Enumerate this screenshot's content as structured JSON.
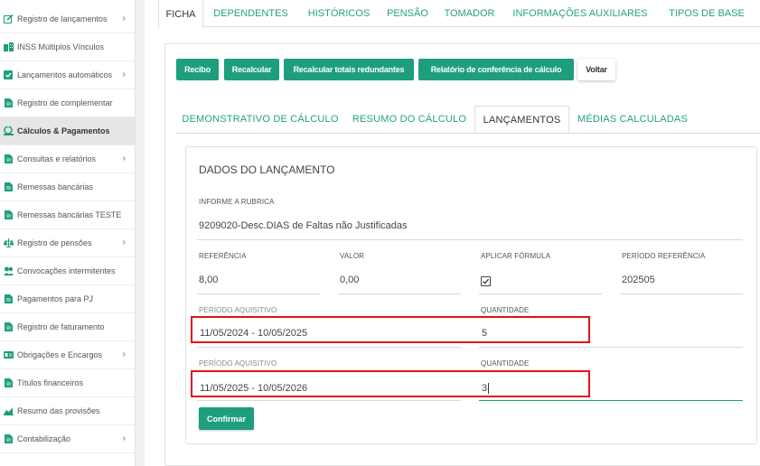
{
  "sidebar": {
    "items": [
      {
        "label": "Registro de lançamentos",
        "icon": "edit-icon",
        "chevron": true
      },
      {
        "label": "INSS Múltiplos Vínculos",
        "icon": "building-icon",
        "chevron": false
      },
      {
        "label": "Lançamentos automáticos",
        "icon": "check-square-icon",
        "chevron": true
      },
      {
        "label": "Registro de complementar",
        "icon": "document-icon",
        "chevron": false
      },
      {
        "label": "Cálculos & Pagamentos",
        "icon": "money-icon",
        "chevron": false,
        "active": true
      },
      {
        "label": "Consultas e relatórios",
        "icon": "document-icon",
        "chevron": true
      },
      {
        "label": "Remessas bancárias",
        "icon": "document-icon",
        "chevron": false
      },
      {
        "label": "Remessas bancárias TESTE",
        "icon": "document-icon",
        "chevron": false
      },
      {
        "label": "Registro de pensões",
        "icon": "balance-icon",
        "chevron": true
      },
      {
        "label": "Convocações intermitentes",
        "icon": "users-icon",
        "chevron": false
      },
      {
        "label": "Pagamentos para PJ",
        "icon": "document-icon",
        "chevron": false
      },
      {
        "label": "Registro de faturamento",
        "icon": "document-icon",
        "chevron": false
      },
      {
        "label": "Obrigações e Encargos",
        "icon": "id-card-icon",
        "chevron": true
      },
      {
        "label": "Títulos financeiros",
        "icon": "document-icon",
        "chevron": false
      },
      {
        "label": "Resumo das provisões",
        "icon": "area-chart-icon",
        "chevron": false
      },
      {
        "label": "Contabilização",
        "icon": "document-icon",
        "chevron": true
      }
    ]
  },
  "top_tabs": [
    "FICHA",
    "DEPENDENTES",
    "HISTÓRICOS",
    "PENSÃO",
    "TOMADOR",
    "INFORMAÇÕES AUXILIARES",
    "TIPOS DE BASE"
  ],
  "toolbar": {
    "recibo": "Recibo",
    "recalcular": "Recalcular",
    "recalcular_totais": "Recalcular totais redundantes",
    "relatorio": "Relatório de conferência de cálculo",
    "voltar": "Voltar"
  },
  "inner_tabs": [
    "DEMONSTRATIVO DE CÁLCULO",
    "RESUMO DO CÁLCULO",
    "LANÇAMENTOS",
    "MÉDIAS CALCULADAS"
  ],
  "panel": {
    "title": "DADOS DO LANÇAMENTO",
    "rubrica_label": "INFORME A RUBRICA",
    "rubrica_value": "9209020-Desc.DIAS de Faltas não Justificadas",
    "referencia_label": "REFERÊNCIA",
    "referencia_value": "8,00",
    "valor_label": "VALOR",
    "valor_value": "0,00",
    "aplicar_formula_label": "APLICAR FÓRMULA",
    "aplicar_formula_checked": true,
    "periodo_referencia_label": "PERÍODO REFERÊNCIA",
    "periodo_referencia_value": "202505",
    "periodos": [
      {
        "periodo_label": "PERÍODO AQUISITIVO",
        "periodo_value": "11/05/2024 - 10/05/2025",
        "quantidade_label": "QUANTIDADE",
        "quantidade_value": "5"
      },
      {
        "periodo_label": "PERÍODO AQUISITIVO",
        "periodo_value": "11/05/2025 - 10/05/2026",
        "quantidade_label": "QUANTIDADE",
        "quantidade_value": "3"
      }
    ],
    "confirmar": "Confirmar"
  },
  "colors": {
    "accent": "#1e9e7d",
    "highlight": "#e0131b"
  }
}
